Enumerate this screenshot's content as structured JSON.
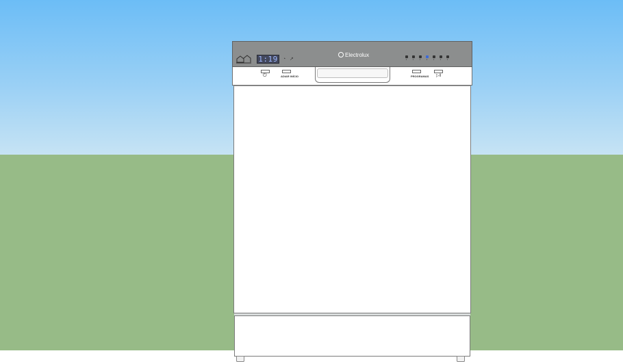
{
  "scene": {
    "sky_color": "#6cbdf6",
    "ground_color": "#97bb87"
  },
  "appliance": {
    "brand": "Electrolux",
    "display_time": "1:19",
    "panel_color": "#8c8e8e",
    "body_color": "#ffffff",
    "left_buttons": [
      {
        "label": "",
        "icon": "power-icon",
        "glyph": "⏻"
      },
      {
        "label": "ADIAR INÍCIO",
        "icon": "",
        "glyph": ""
      }
    ],
    "right_buttons": [
      {
        "label": "PROGRAMAS",
        "icon": "",
        "glyph": ""
      },
      {
        "label": "",
        "icon": "start-pause-icon",
        "glyph": "▷‖"
      }
    ],
    "indicators": [
      {
        "icon": "rinse-icon",
        "active": false
      },
      {
        "icon": "eco-icon",
        "active": false
      },
      {
        "icon": "normal-icon",
        "active": false
      },
      {
        "icon": "intensive-icon",
        "active": true
      },
      {
        "icon": "fast-icon",
        "active": false
      },
      {
        "icon": "glass-icon",
        "active": false
      },
      {
        "icon": "soak-icon",
        "active": false
      }
    ],
    "small_status_icons": [
      "timer-icon",
      "delay-icon"
    ]
  }
}
